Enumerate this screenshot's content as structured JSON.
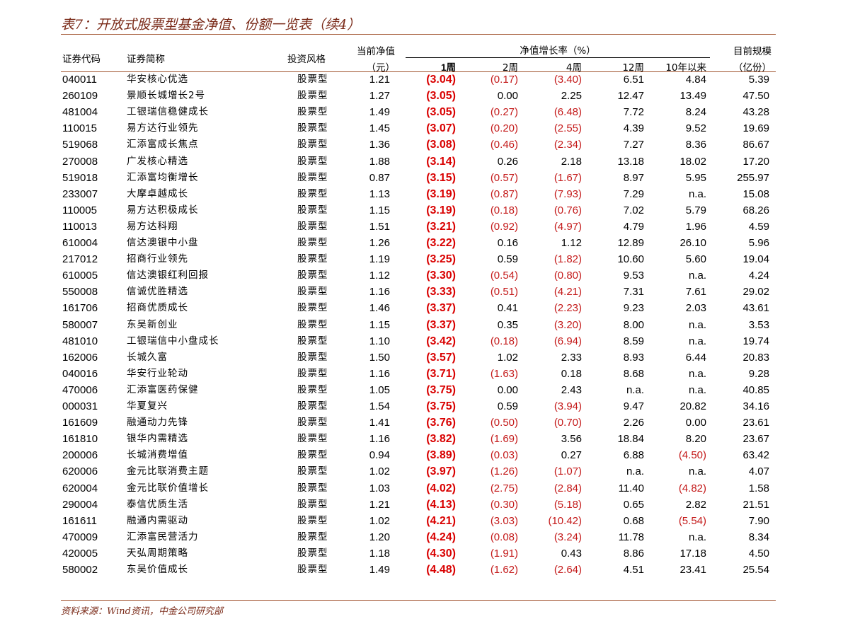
{
  "title": "表7：开放式股票型基金净值、份额一览表（续4）",
  "headers": {
    "code": "证券代码",
    "name": "证券简称",
    "style": "投资风格",
    "nav_top": "当前净值",
    "nav_unit": "（元）",
    "growth": "净值增长率（%）",
    "w1": "1周",
    "w2": "2周",
    "w4": "4周",
    "w12": "12周",
    "y10": "10年以来",
    "aum_top": "目前规模",
    "aum_unit": "（亿份）"
  },
  "rows": [
    {
      "code": "040011",
      "name": "华安核心优选",
      "style": "股票型",
      "nav": "1.21",
      "w1": "(3.04)",
      "w2": "(0.17)",
      "w4": "(3.40)",
      "w12": "6.51",
      "y10": "4.84",
      "aum": "5.39"
    },
    {
      "code": "260109",
      "name": "景顺长城增长2号",
      "style": "股票型",
      "nav": "1.27",
      "w1": "(3.05)",
      "w2": "0.00",
      "w4": "2.25",
      "w12": "12.47",
      "y10": "13.49",
      "aum": "47.50"
    },
    {
      "code": "481004",
      "name": "工银瑞信稳健成长",
      "style": "股票型",
      "nav": "1.49",
      "w1": "(3.05)",
      "w2": "(0.27)",
      "w4": "(6.48)",
      "w12": "7.72",
      "y10": "8.24",
      "aum": "43.28"
    },
    {
      "code": "110015",
      "name": "易方达行业领先",
      "style": "股票型",
      "nav": "1.45",
      "w1": "(3.07)",
      "w2": "(0.20)",
      "w4": "(2.55)",
      "w12": "4.39",
      "y10": "9.52",
      "aum": "19.69"
    },
    {
      "code": "519068",
      "name": "汇添富成长焦点",
      "style": "股票型",
      "nav": "1.36",
      "w1": "(3.08)",
      "w2": "(0.46)",
      "w4": "(2.34)",
      "w12": "7.27",
      "y10": "8.36",
      "aum": "86.67"
    },
    {
      "code": "270008",
      "name": "广发核心精选",
      "style": "股票型",
      "nav": "1.88",
      "w1": "(3.14)",
      "w2": "0.26",
      "w4": "2.18",
      "w12": "13.18",
      "y10": "18.02",
      "aum": "17.20"
    },
    {
      "code": "519018",
      "name": "汇添富均衡增长",
      "style": "股票型",
      "nav": "0.87",
      "w1": "(3.15)",
      "w2": "(0.57)",
      "w4": "(1.67)",
      "w12": "8.97",
      "y10": "5.95",
      "aum": "255.97"
    },
    {
      "code": "233007",
      "name": "大摩卓越成长",
      "style": "股票型",
      "nav": "1.13",
      "w1": "(3.19)",
      "w2": "(0.87)",
      "w4": "(7.93)",
      "w12": "7.29",
      "y10": "n.a.",
      "aum": "15.08"
    },
    {
      "code": "110005",
      "name": "易方达积极成长",
      "style": "股票型",
      "nav": "1.15",
      "w1": "(3.19)",
      "w2": "(0.18)",
      "w4": "(0.76)",
      "w12": "7.02",
      "y10": "5.79",
      "aum": "68.26"
    },
    {
      "code": "110013",
      "name": "易方达科翔",
      "style": "股票型",
      "nav": "1.51",
      "w1": "(3.21)",
      "w2": "(0.92)",
      "w4": "(4.97)",
      "w12": "4.79",
      "y10": "1.96",
      "aum": "4.59"
    },
    {
      "code": "610004",
      "name": "信达澳银中小盘",
      "style": "股票型",
      "nav": "1.26",
      "w1": "(3.22)",
      "w2": "0.16",
      "w4": "1.12",
      "w12": "12.89",
      "y10": "26.10",
      "aum": "5.96"
    },
    {
      "code": "217012",
      "name": "招商行业领先",
      "style": "股票型",
      "nav": "1.19",
      "w1": "(3.25)",
      "w2": "0.59",
      "w4": "(1.82)",
      "w12": "10.60",
      "y10": "5.60",
      "aum": "19.04"
    },
    {
      "code": "610005",
      "name": "信达澳银红利回报",
      "style": "股票型",
      "nav": "1.12",
      "w1": "(3.30)",
      "w2": "(0.54)",
      "w4": "(0.80)",
      "w12": "9.53",
      "y10": "n.a.",
      "aum": "4.24"
    },
    {
      "code": "550008",
      "name": "信诚优胜精选",
      "style": "股票型",
      "nav": "1.16",
      "w1": "(3.33)",
      "w2": "(0.51)",
      "w4": "(4.21)",
      "w12": "7.31",
      "y10": "7.61",
      "aum": "29.02"
    },
    {
      "code": "161706",
      "name": "招商优质成长",
      "style": "股票型",
      "nav": "1.46",
      "w1": "(3.37)",
      "w2": "0.41",
      "w4": "(2.23)",
      "w12": "9.23",
      "y10": "2.03",
      "aum": "43.61"
    },
    {
      "code": "580007",
      "name": "东吴新创业",
      "style": "股票型",
      "nav": "1.15",
      "w1": "(3.37)",
      "w2": "0.35",
      "w4": "(3.20)",
      "w12": "8.00",
      "y10": "n.a.",
      "aum": "3.53"
    },
    {
      "code": "481010",
      "name": "工银瑞信中小盘成长",
      "style": "股票型",
      "nav": "1.10",
      "w1": "(3.42)",
      "w2": "(0.18)",
      "w4": "(6.94)",
      "w12": "8.59",
      "y10": "n.a.",
      "aum": "19.74"
    },
    {
      "code": "162006",
      "name": "长城久富",
      "style": "股票型",
      "nav": "1.50",
      "w1": "(3.57)",
      "w2": "1.02",
      "w4": "2.33",
      "w12": "8.93",
      "y10": "6.44",
      "aum": "20.83"
    },
    {
      "code": "040016",
      "name": "华安行业轮动",
      "style": "股票型",
      "nav": "1.16",
      "w1": "(3.71)",
      "w2": "(1.63)",
      "w4": "0.18",
      "w12": "8.68",
      "y10": "n.a.",
      "aum": "9.28"
    },
    {
      "code": "470006",
      "name": "汇添富医药保健",
      "style": "股票型",
      "nav": "1.05",
      "w1": "(3.75)",
      "w2": "0.00",
      "w4": "2.43",
      "w12": "n.a.",
      "y10": "n.a.",
      "aum": "40.85"
    },
    {
      "code": "000031",
      "name": "华夏复兴",
      "style": "股票型",
      "nav": "1.54",
      "w1": "(3.75)",
      "w2": "0.59",
      "w4": "(3.94)",
      "w12": "9.47",
      "y10": "20.82",
      "aum": "34.16"
    },
    {
      "code": "161609",
      "name": "融通动力先锋",
      "style": "股票型",
      "nav": "1.41",
      "w1": "(3.76)",
      "w2": "(0.50)",
      "w4": "(0.70)",
      "w12": "2.26",
      "y10": "0.00",
      "aum": "23.61"
    },
    {
      "code": "161810",
      "name": "银华内需精选",
      "style": "股票型",
      "nav": "1.16",
      "w1": "(3.82)",
      "w2": "(1.69)",
      "w4": "3.56",
      "w12": "18.84",
      "y10": "8.20",
      "aum": "23.67"
    },
    {
      "code": "200006",
      "name": "长城消费增值",
      "style": "股票型",
      "nav": "0.94",
      "w1": "(3.89)",
      "w2": "(0.03)",
      "w4": "0.27",
      "w12": "6.88",
      "y10": "(4.50)",
      "aum": "63.42"
    },
    {
      "code": "620006",
      "name": "金元比联消费主题",
      "style": "股票型",
      "nav": "1.02",
      "w1": "(3.97)",
      "w2": "(1.26)",
      "w4": "(1.07)",
      "w12": "n.a.",
      "y10": "n.a.",
      "aum": "4.07"
    },
    {
      "code": "620004",
      "name": "金元比联价值增长",
      "style": "股票型",
      "nav": "1.03",
      "w1": "(4.02)",
      "w2": "(2.75)",
      "w4": "(2.84)",
      "w12": "11.40",
      "y10": "(4.82)",
      "aum": "1.58"
    },
    {
      "code": "290004",
      "name": "泰信优质生活",
      "style": "股票型",
      "nav": "1.21",
      "w1": "(4.13)",
      "w2": "(0.30)",
      "w4": "(5.18)",
      "w12": "0.65",
      "y10": "2.82",
      "aum": "21.51"
    },
    {
      "code": "161611",
      "name": "融通内需驱动",
      "style": "股票型",
      "nav": "1.02",
      "w1": "(4.21)",
      "w2": "(3.03)",
      "w4": "(10.42)",
      "w12": "0.68",
      "y10": "(5.54)",
      "aum": "7.90"
    },
    {
      "code": "470009",
      "name": "汇添富民营活力",
      "style": "股票型",
      "nav": "1.20",
      "w1": "(4.24)",
      "w2": "(0.08)",
      "w4": "(3.24)",
      "w12": "11.78",
      "y10": "n.a.",
      "aum": "8.34"
    },
    {
      "code": "420005",
      "name": "天弘周期策略",
      "style": "股票型",
      "nav": "1.18",
      "w1": "(4.30)",
      "w2": "(1.91)",
      "w4": "0.43",
      "w12": "8.86",
      "y10": "17.18",
      "aum": "4.50"
    },
    {
      "code": "580002",
      "name": "东吴价值成长",
      "style": "股票型",
      "nav": "1.49",
      "w1": "(4.48)",
      "w2": "(1.62)",
      "w4": "(2.64)",
      "w12": "4.51",
      "y10": "23.41",
      "aum": "25.54"
    }
  ],
  "source": "资料来源：Wind资讯，中金公司研究部"
}
